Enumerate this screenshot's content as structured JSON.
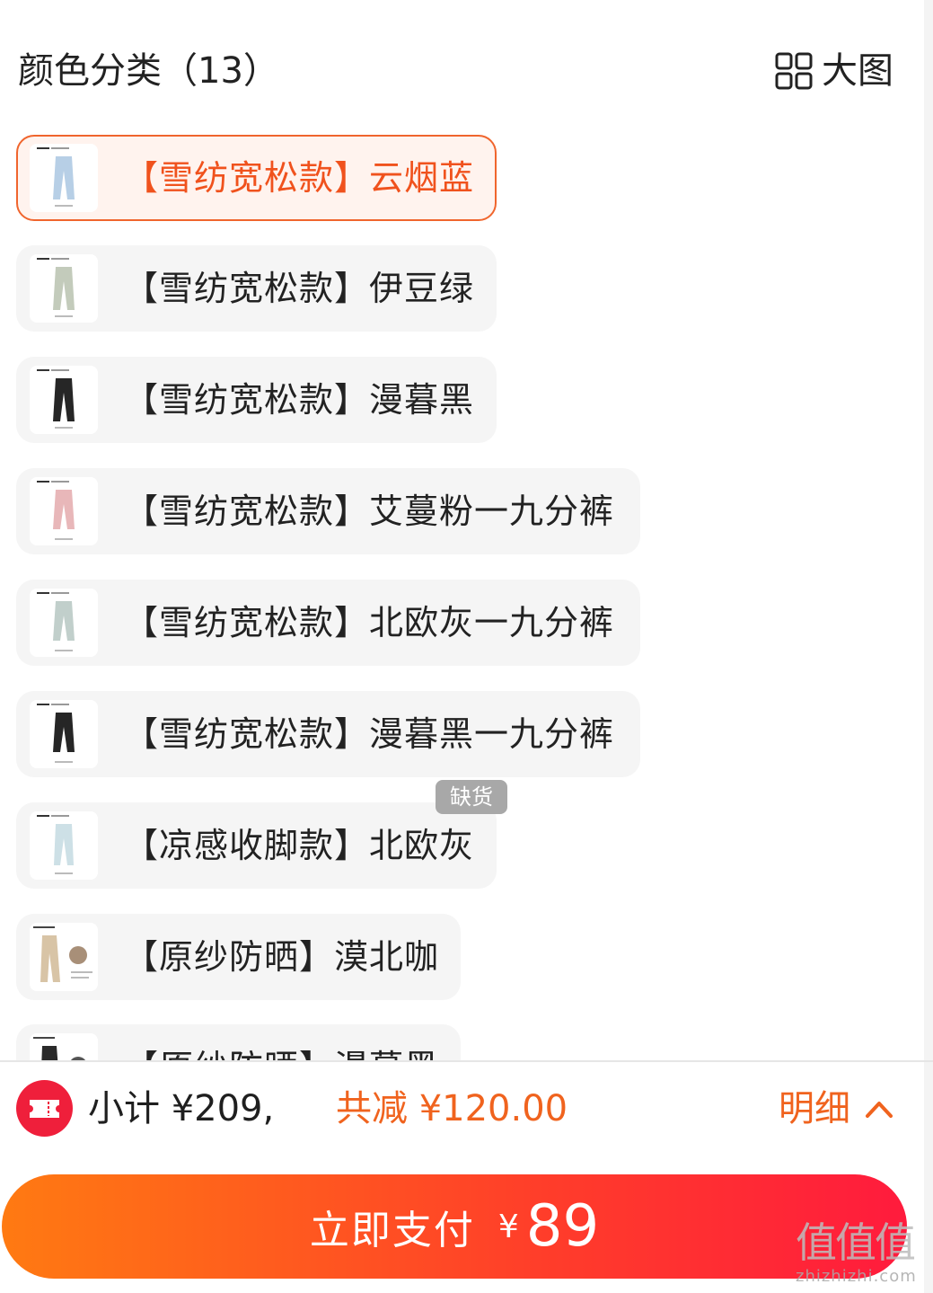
{
  "header": {
    "title": "颜色分类（13）",
    "bigview_label": "大图"
  },
  "options": [
    {
      "label": "【雪纺宽松款】云烟蓝",
      "selected": true,
      "thumb_color": "#b7cfe6"
    },
    {
      "label": "【雪纺宽松款】伊豆绿",
      "selected": false,
      "thumb_color": "#c3cbbb"
    },
    {
      "label": "【雪纺宽松款】漫暮黑",
      "selected": false,
      "thumb_color": "#262626"
    },
    {
      "label": "【雪纺宽松款】艾蔓粉一九分裤",
      "selected": false,
      "thumb_color": "#e8b7b9"
    },
    {
      "label": "【雪纺宽松款】北欧灰一九分裤",
      "selected": false,
      "thumb_color": "#c1cfcb"
    },
    {
      "label": "【雪纺宽松款】漫暮黑一九分裤",
      "selected": false,
      "thumb_color": "#262626"
    },
    {
      "label": "【凉感收脚款】北欧灰",
      "selected": false,
      "thumb_color": "#cde0e6"
    },
    {
      "label": "【原纱防晒】漠北咖",
      "selected": false,
      "thumb_color": "#d8c4a6"
    },
    {
      "label": "【原纱防晒】漫暮黑",
      "selected": false,
      "thumb_color": "#2a2a2a"
    }
  ],
  "badge": {
    "out_of_stock": "缺货"
  },
  "summary": {
    "subtotal": "小计 ¥209,",
    "discount": "共减 ¥120.00",
    "detail_label": "明细"
  },
  "pay": {
    "label": "立即支付",
    "currency": "¥",
    "amount": "89"
  },
  "watermark": {
    "main": "值值值",
    "domain": "zhizhizhi.com"
  },
  "colors": {
    "accent": "#f0631e",
    "selected_border": "#f0652d",
    "pay_start": "#ff7a12",
    "pay_end": "#ff1b3d",
    "coupon_red": "#ef1f3b"
  }
}
